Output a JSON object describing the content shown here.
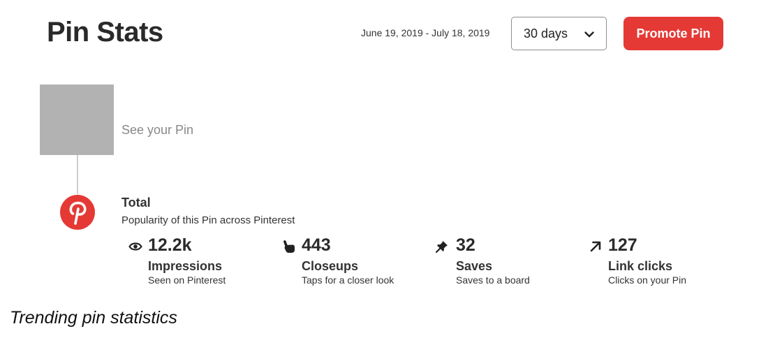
{
  "header": {
    "title": "Pin Stats",
    "date_range": "June 19, 2019 - July 18, 2019",
    "range_select": {
      "value": "30 days",
      "icon": "chevron-down-icon"
    },
    "promote_label": "Promote Pin",
    "accent_color": "#e53935"
  },
  "pin": {
    "see_label": "See your Pin"
  },
  "total": {
    "title": "Total",
    "subtitle": "Popularity of this Pin across Pinterest",
    "logo_icon": "pinterest-logo-icon",
    "stats": [
      {
        "icon": "eye-icon",
        "value": "12.2k",
        "name": "Impressions",
        "desc": "Seen on Pinterest"
      },
      {
        "icon": "hand-pointer-icon",
        "value": "443",
        "name": "Closeups",
        "desc": "Taps for a closer look"
      },
      {
        "icon": "pin-icon",
        "value": "32",
        "name": "Saves",
        "desc": "Saves to a board"
      },
      {
        "icon": "arrow-up-right-icon",
        "value": "127",
        "name": "Link clicks",
        "desc": "Clicks on your Pin"
      }
    ]
  },
  "caption": "Trending pin statistics"
}
